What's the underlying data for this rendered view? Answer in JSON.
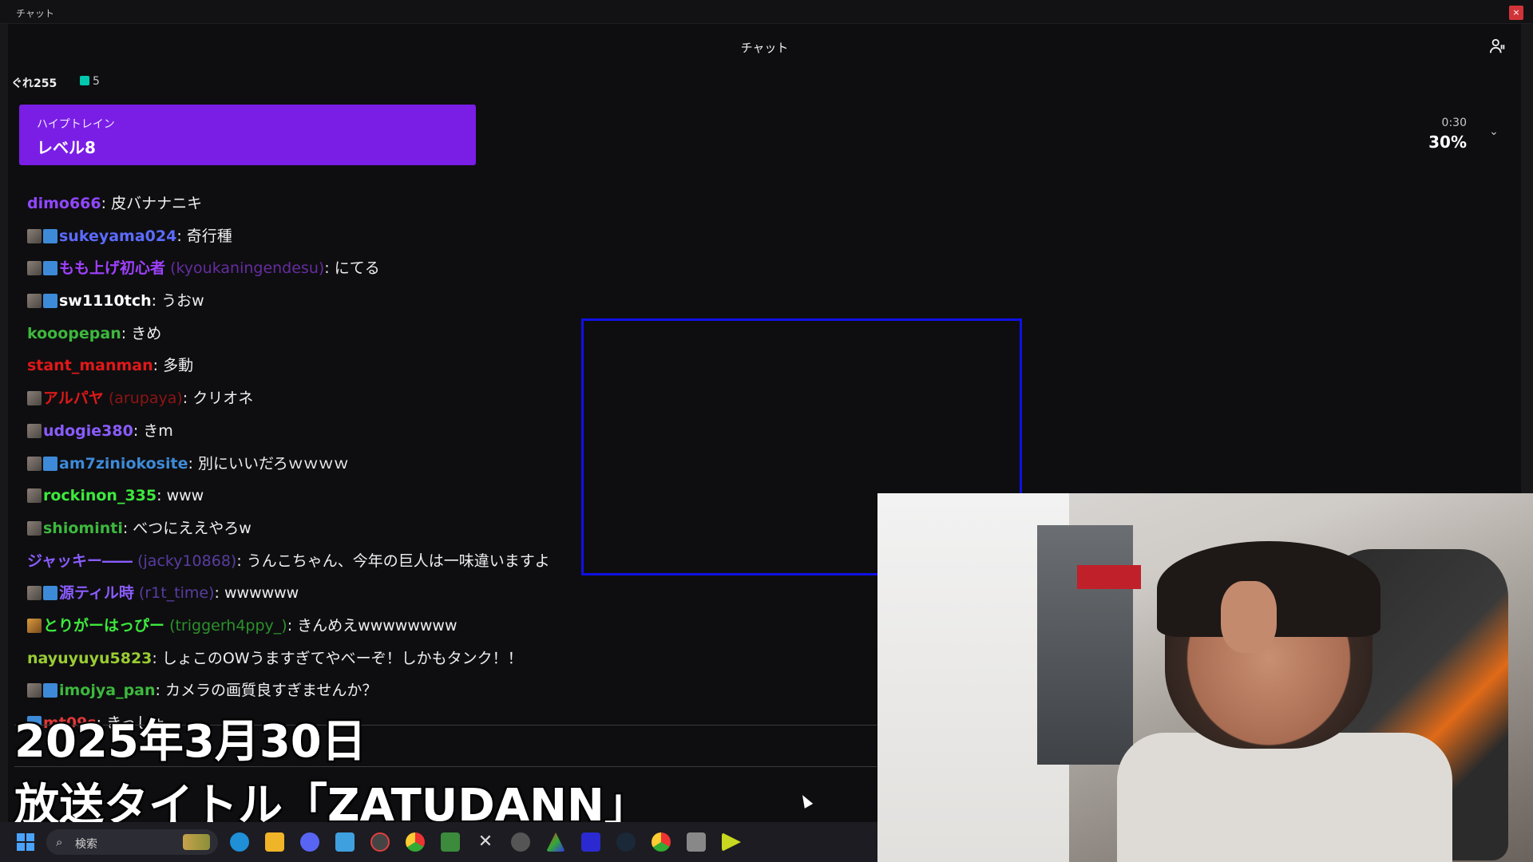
{
  "window": {
    "title": "チャット",
    "close_glyph": "×"
  },
  "chat": {
    "header_title": "チャット",
    "stats": {
      "bits": "ぐれ255",
      "gifts": "5"
    },
    "hype_train": {
      "label": "ハイプトレイン",
      "level": "レベル8",
      "timer": "0:30",
      "percent": "30%"
    },
    "messages": [
      {
        "badges": [],
        "user": "dimo666",
        "alias": "",
        "text": "皮バナナニキ",
        "color": "#9147ff"
      },
      {
        "badges": [
          "av",
          "sub"
        ],
        "user": "sukeyama024",
        "alias": "",
        "text": "奇行種",
        "color": "#5c6bff"
      },
      {
        "badges": [
          "av",
          "sub"
        ],
        "user": "もも上げ初心者",
        "alias": "(kyoukaningendesu)",
        "text": "にてる",
        "color": "#a040ff"
      },
      {
        "badges": [
          "av",
          "sub"
        ],
        "user": "sw1110tch",
        "alias": "",
        "text": "うおw",
        "color": "#ffffff"
      },
      {
        "badges": [],
        "user": "kooopepan",
        "alias": "",
        "text": "きめ",
        "color": "#3db83d"
      },
      {
        "badges": [],
        "user": "stant_manman",
        "alias": "",
        "text": "多動",
        "color": "#e01818"
      },
      {
        "badges": [
          "av"
        ],
        "user": "アルパヤ",
        "alias": "(arupaya)",
        "text": "クリオネ",
        "color": "#e01818"
      },
      {
        "badges": [
          "av"
        ],
        "user": "udogie380",
        "alias": "",
        "text": "きm",
        "color": "#8a5cff"
      },
      {
        "badges": [
          "av",
          "sub"
        ],
        "user": "am7ziniokosite",
        "alias": "",
        "text": "別にいいだろｗｗｗｗ",
        "color": "#3d8ad8"
      },
      {
        "badges": [
          "av"
        ],
        "user": "rockinon_335",
        "alias": "",
        "text": "www",
        "color": "#3de83d"
      },
      {
        "badges": [
          "av"
        ],
        "user": "shiominti",
        "alias": "",
        "text": "べつにええやろw",
        "color": "#3db83d"
      },
      {
        "badges": [],
        "user": "ジャッキー――",
        "alias": "(jacky10868)",
        "text": "うんこちゃん、今年の巨人は一味違いますよ",
        "color": "#8a5cff"
      },
      {
        "badges": [
          "av",
          "sub"
        ],
        "user": "源ティル時",
        "alias": "(r1t_time)",
        "text": "wwwwww",
        "color": "#8a5cff"
      },
      {
        "badges": [
          "gift2"
        ],
        "user": "とりがーはっぴー",
        "alias": "(triggerh4ppy_)",
        "text": "きんめえwwwwwwww",
        "color": "#3de83d"
      },
      {
        "badges": [],
        "user": "nayuyuyu5823",
        "alias": "",
        "text": "しょこのOWうますぎてやべーぞ！しかもタンク！！",
        "color": "#9acd32"
      },
      {
        "badges": [
          "av",
          "sub"
        ],
        "user": "imojya_pan",
        "alias": "",
        "text": "カメラの画質良すぎませんか？",
        "color": "#3db83d"
      },
      {
        "badges": [
          "sub"
        ],
        "user": "mt09s",
        "alias": "",
        "text": "きっしょ",
        "color": "#e03838"
      }
    ]
  },
  "captions": {
    "date": "2025年3月30日",
    "title": "放送タイトル「ZATUDANN」"
  },
  "taskbar": {
    "search_label": "検索"
  },
  "icons": {
    "users": "users-icon",
    "chevron": "chevron-down-icon",
    "search": "search-icon",
    "start": "windows-start-icon"
  },
  "colors": {
    "hype_purple": "#7a1ee6",
    "highlight_box": "#1010e6",
    "background": "#0e0e10"
  }
}
